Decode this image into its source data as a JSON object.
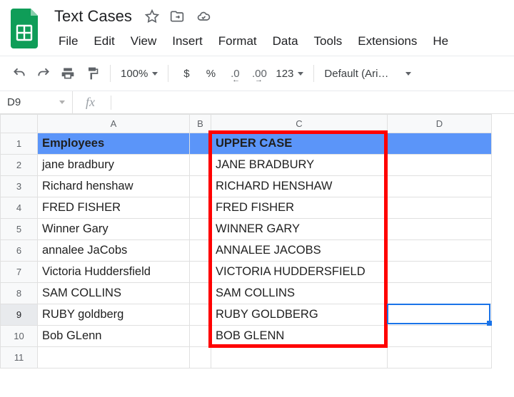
{
  "doc": {
    "title": "Text Cases"
  },
  "menu": {
    "file": "File",
    "edit": "Edit",
    "view": "View",
    "insert": "Insert",
    "format": "Format",
    "data": "Data",
    "tools": "Tools",
    "extensions": "Extensions",
    "help": "He"
  },
  "toolbar": {
    "zoom": "100%",
    "currency": "$",
    "percent": "%",
    "dec_dec": ".0",
    "inc_dec": ".00",
    "numfmt": "123",
    "font": "Default (Ari…"
  },
  "namebox": "D9",
  "fx": "fx",
  "columns": {
    "A": "A",
    "B": "B",
    "C": "C",
    "D": "D"
  },
  "colwidths": {
    "A": 213,
    "B": 30,
    "C": 247,
    "D": 146
  },
  "rows": [
    {
      "n": "1",
      "A": "Employees",
      "C": "UPPER CASE",
      "header": true
    },
    {
      "n": "2",
      "A": "jane bradbury",
      "C": "JANE BRADBURY"
    },
    {
      "n": "3",
      "A": "Richard henshaw",
      "C": "RICHARD HENSHAW"
    },
    {
      "n": "4",
      "A": "FRED FISHER",
      "C": "FRED FISHER"
    },
    {
      "n": "5",
      "A": "Winner Gary",
      "C": "WINNER GARY"
    },
    {
      "n": "6",
      "A": "annalee JaCobs",
      "C": "ANNALEE JACOBS"
    },
    {
      "n": "7",
      "A": "Victoria Huddersfield",
      "C": "VICTORIA HUDDERSFIELD"
    },
    {
      "n": "8",
      "A": "SAM COLLINS",
      "C": "SAM COLLINS"
    },
    {
      "n": "9",
      "A": "RUBY goldberg",
      "C": "RUBY GOLDBERG"
    },
    {
      "n": "10",
      "A": "Bob GLenn",
      "C": "BOB GLENN"
    },
    {
      "n": "11",
      "A": "",
      "C": ""
    }
  ],
  "selected_row": "9"
}
